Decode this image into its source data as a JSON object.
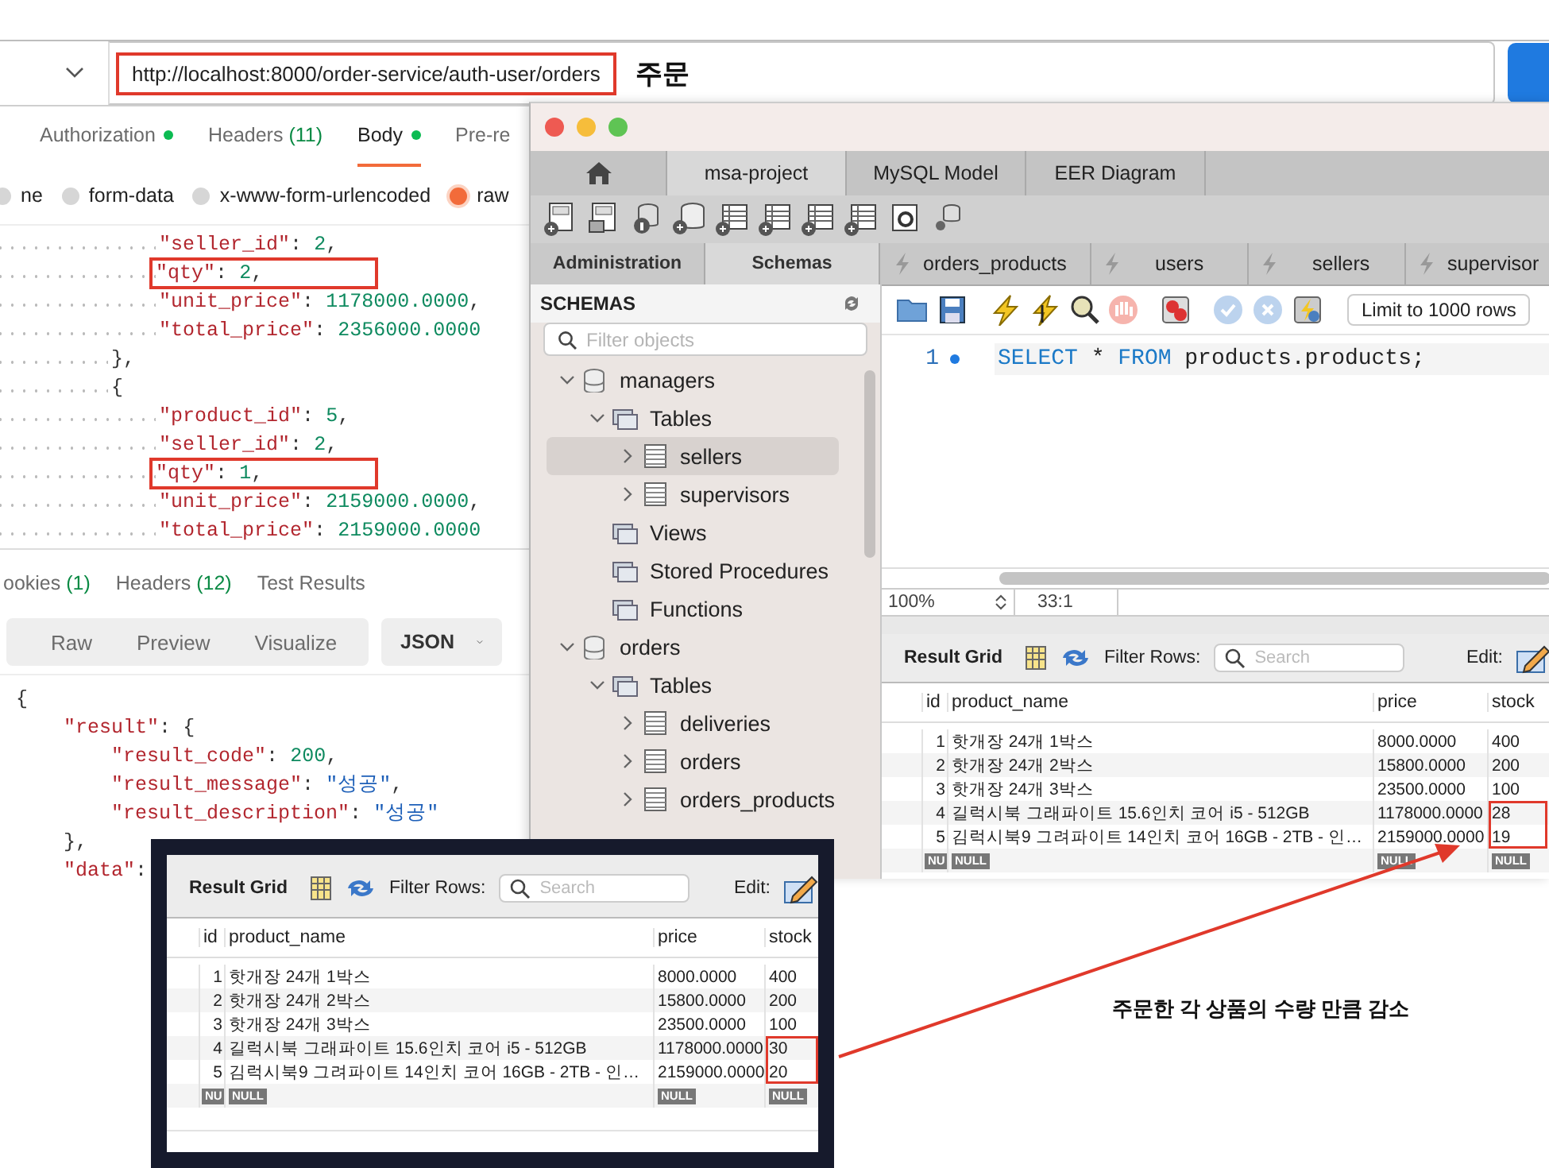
{
  "postman": {
    "url": "http://localhost:8000/order-service/auth-user/orders",
    "url_flagged": true,
    "url_note": "주문",
    "request_tabs": [
      {
        "label": "Authorization",
        "dot": true,
        "selected": false
      },
      {
        "label": "Headers",
        "count": "(11)",
        "selected": false
      },
      {
        "label": "Body",
        "dot": true,
        "selected": true
      },
      {
        "label": "Pre-re",
        "selected": false
      }
    ],
    "body_types": [
      {
        "label": "ne",
        "selected": false
      },
      {
        "label": "form-data",
        "selected": false
      },
      {
        "label": "x-www-form-urlencoded",
        "selected": false
      },
      {
        "label": "raw",
        "selected": true
      }
    ],
    "request_lines": [
      {
        "text": "            \"seller_id\": 2,",
        "flagged": false
      },
      {
        "text": "            \"qty\": 2,",
        "flagged": true
      },
      {
        "text": "            \"unit_price\": 1178000.0000,",
        "flagged": false
      },
      {
        "text": "            \"total_price\": 2356000.0000",
        "flagged": false
      },
      {
        "text": "        },",
        "flagged": false
      },
      {
        "text": "        {",
        "flagged": false
      },
      {
        "text": "            \"product_id\": 5,",
        "flagged": false
      },
      {
        "text": "            \"seller_id\": 2,",
        "flagged": false
      },
      {
        "text": "            \"qty\": 1,",
        "flagged": true
      },
      {
        "text": "            \"unit_price\": 2159000.0000,",
        "flagged": false
      },
      {
        "text": "            \"total_price\": 2159000.0000",
        "flagged": false
      }
    ],
    "response_tabs": [
      {
        "label": "ookies",
        "count": "(1)"
      },
      {
        "label": "Headers",
        "count": "(12)"
      },
      {
        "label": "Test Results"
      }
    ],
    "view_modes": [
      "Raw",
      "Preview",
      "Visualize"
    ],
    "format": "JSON",
    "response_lines": [
      "{",
      "    \"result\": {",
      "        \"result_code\": 200,",
      "        \"result_message\": \"성공\",",
      "        \"result_description\": \"성공\"",
      "    },",
      "    \"data\":"
    ]
  },
  "workbench": {
    "tabs": [
      {
        "kind": "home",
        "selected": false
      },
      {
        "kind": "text",
        "label": "msa-project",
        "selected": true
      },
      {
        "kind": "text",
        "label": "MySQL Model",
        "selected": false
      },
      {
        "kind": "text",
        "label": "EER Diagram",
        "selected": false
      }
    ],
    "sidebar_tabs": [
      {
        "label": "Administration",
        "selected": false
      },
      {
        "label": "Schemas",
        "selected": true
      }
    ],
    "schemas_title": "SCHEMAS",
    "filter_placeholder": "Filter objects",
    "tree": [
      {
        "label": "managers",
        "kind": "schema",
        "expanded": true,
        "selected": false,
        "children": [
          {
            "label": "Tables",
            "kind": "folder",
            "expanded": true,
            "selected": false,
            "children": [
              {
                "label": "sellers",
                "kind": "table",
                "expanded": false,
                "selected": true
              },
              {
                "label": "supervisors",
                "kind": "table",
                "expanded": false,
                "selected": false
              }
            ]
          },
          {
            "label": "Views",
            "kind": "folder",
            "selected": false
          },
          {
            "label": "Stored Procedures",
            "kind": "folder",
            "selected": false
          },
          {
            "label": "Functions",
            "kind": "folder",
            "selected": false
          }
        ]
      },
      {
        "label": "orders",
        "kind": "schema",
        "expanded": true,
        "selected": false,
        "children": [
          {
            "label": "Tables",
            "kind": "folder",
            "expanded": true,
            "selected": false,
            "children": [
              {
                "label": "deliveries",
                "kind": "table",
                "expanded": false,
                "selected": false
              },
              {
                "label": "orders",
                "kind": "table",
                "expanded": false,
                "selected": false
              },
              {
                "label": "orders_products",
                "kind": "table",
                "expanded": false,
                "selected": false
              }
            ]
          }
        ]
      }
    ],
    "query_tabs": [
      "orders_products",
      "users",
      "sellers",
      "supervisor"
    ],
    "limit": "Limit to 1000 rows",
    "editor_lines": [
      {
        "number": "1",
        "marker": true,
        "tokens": [
          {
            "text": "SELECT",
            "kind": "keyword"
          },
          {
            "text": "*",
            "kind": "plain"
          },
          {
            "text": "FROM",
            "kind": "keyword"
          },
          {
            "text": "products.products;",
            "kind": "plain"
          }
        ]
      }
    ],
    "zoom": "100%",
    "cursor": "33:1",
    "result_grid": {
      "title": "Result Grid",
      "filter_label": "Filter Rows:",
      "search_placeholder": "Search",
      "edit_label": "Edit:",
      "columns": [
        "id",
        "product_name",
        "price",
        "stock"
      ],
      "rows": [
        {
          "cells": [
            "1",
            "핫개장 24개 1박스",
            "8000.0000",
            "400"
          ],
          "flagged": false
        },
        {
          "cells": [
            "2",
            "핫개장 24개 2박스",
            "15800.0000",
            "200"
          ],
          "flagged": false
        },
        {
          "cells": [
            "3",
            "핫개장 24개 3박스",
            "23500.0000",
            "100"
          ],
          "flagged": false
        },
        {
          "cells": [
            "4",
            "길럭시북 그래파이트 15.6인치 코어 i5 - 512GB",
            "1178000.0000",
            "28"
          ],
          "flagged": true
        },
        {
          "cells": [
            "5",
            "김럭시북9 그려파이트 14인치 코어 16GB - 2TB - 인…",
            "2159000.0000",
            "19"
          ],
          "flagged": true
        }
      ],
      "null_row": [
        "NU",
        "NULL",
        "NULL",
        "NULL"
      ]
    }
  },
  "inset_grid": {
    "title": "Result Grid",
    "filter_label": "Filter Rows:",
    "search_placeholder": "Search",
    "edit_label": "Edit:",
    "columns": [
      "id",
      "product_name",
      "price",
      "stock"
    ],
    "rows": [
      {
        "cells": [
          "1",
          "핫개장 24개 1박스",
          "8000.0000",
          "400"
        ],
        "flagged": false
      },
      {
        "cells": [
          "2",
          "핫개장 24개 2박스",
          "15800.0000",
          "200"
        ],
        "flagged": false
      },
      {
        "cells": [
          "3",
          "핫개장 24개 3박스",
          "23500.0000",
          "100"
        ],
        "flagged": false
      },
      {
        "cells": [
          "4",
          "길럭시북 그래파이트 15.6인치 코어 i5 - 512GB",
          "1178000.0000",
          "30"
        ],
        "flagged": true
      },
      {
        "cells": [
          "5",
          "김럭시북9 그려파이트 14인치 코어 16GB - 2TB - 인…",
          "2159000.0000",
          "20"
        ],
        "flagged": true
      }
    ],
    "null_row": [
      "NU",
      "NULL",
      "NULL",
      "NULL"
    ]
  },
  "annotation": "주문한 각 상품의 수량 만큼 감소"
}
